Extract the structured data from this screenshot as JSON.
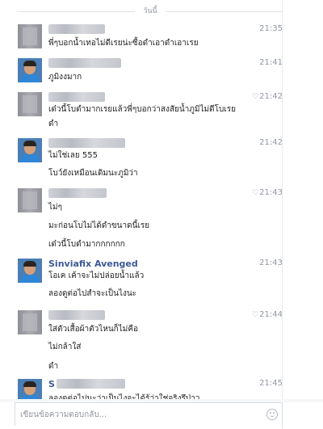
{
  "header": {
    "date_label": "วันนี้"
  },
  "messages": [
    {
      "avatar": "blurred-avatar",
      "name": "",
      "time": "21:35",
      "read_icon": "",
      "lines": [
        "พี่ๆบอกน้ำเทอไม่ดีเรยน่ะซื้อดำเอาดำเอาเรย"
      ]
    },
    {
      "avatar": "boy-avatar",
      "name": "",
      "time": "21:41",
      "read_icon": "",
      "lines": [
        "ภูมิงงมาก"
      ]
    },
    {
      "avatar": "blurred-avatar",
      "name": "",
      "time": "21:42",
      "read_icon": "♡",
      "lines": [
        "เด๋วนี้โบดำมากเรยแล้วพี่ๆบอกว่าสงสัยน้ำภูมิไม่ดีโบเรย",
        "ดำ"
      ]
    },
    {
      "avatar": "boy-avatar",
      "name": "",
      "time": "21:42",
      "read_icon": "",
      "lines": [
        "ไม่ใช่เลย 555",
        "โบว์ยังเหมือนเดิมนะภูมิว่า"
      ]
    },
    {
      "avatar": "blurred-avatar",
      "name": "",
      "time": "21:43",
      "read_icon": "♡",
      "lines": [
        "ไม่ๆ",
        "มะก่อนโบไม่ได้ดำขนาดนี้เรย",
        "เด๋วนี้โบดำมากกกกกก"
      ]
    },
    {
      "avatar": "boy-avatar",
      "name": "Sinviafix Avenged",
      "time": "21:43",
      "read_icon": "",
      "lines": [
        "โอเค เค้าจะไม่ปล่อยน้ำแล้ว",
        "ลองดูต่อไปสำจะเป็นไงนะ"
      ]
    },
    {
      "avatar": "blurred-avatar",
      "name": "",
      "time": "21:44",
      "read_icon": "♡",
      "lines": [
        "ใส่ตัวเสื้อผ้าตัวไหนก็ไม่คือ",
        "ไม่กล้าใส่",
        "ดำ"
      ]
    },
    {
      "avatar": "boy-avatar",
      "name": "S",
      "time": "21:45",
      "read_icon": "",
      "lines": [
        "ลองดูต่อไปนะว่าเป็นไงจะได้รู้ว่าใช่จริงรึป่าว"
      ]
    }
  ],
  "composer": {
    "placeholder": "เขียนข้อความตอบกลับ...",
    "emoji_icon": "smiley-icon"
  },
  "colors": {
    "name": "#3b5998",
    "time": "#9197a3",
    "text": "#222222"
  }
}
